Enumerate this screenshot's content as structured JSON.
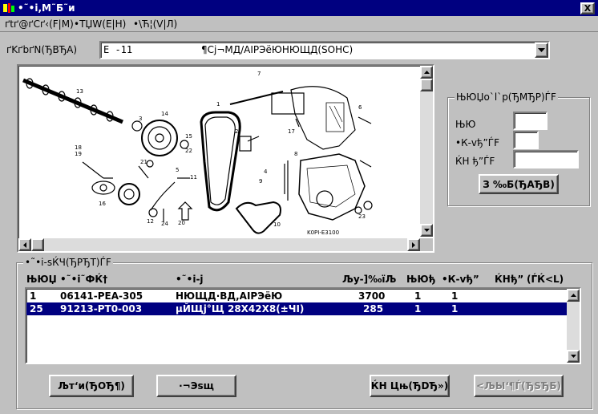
{
  "window": {
    "title": "•˜•i,M˜Б˜и",
    "close_label": "X"
  },
  "menu": {
    "items": [
      "ґtґ@ґCґ‹(F|M)",
      "•TЏW(E|H)",
      "•\\Ћ¦(V|Л)"
    ]
  },
  "model": {
    "label": "ґKґbґN(ЂВЂА)",
    "code": "E  -11",
    "name": "¶Cj¬МД/AIРЭёЮНЮЩД(SOHC)"
  },
  "quantity_panel": {
    "title": "ЊЮЏo`l`p(ЂМЂР)ЃF",
    "fields": [
      {
        "label": "ЊЮ",
        "value": ""
      },
      {
        "label": "•К-vђ”ЃF",
        "value": ""
      },
      {
        "label": "ЌН  ђ”ЃF",
        "value": ""
      }
    ],
    "confirm_label": "З ‰Б(ЂАЂВ)"
  },
  "parts_panel": {
    "title": "•˜•i-sЌЧ(ЂРЂТ)ЃF",
    "columns": [
      "ЊЮЏ",
      "•˜•i˜ФЌ†",
      "•˜•i-j",
      "Љу-]‰їЉ",
      "ЊЮђ",
      "•К-vђ”",
      "ЌНђ”",
      "(ЃЌ<L)"
    ],
    "rows": [
      {
        "no": "1",
        "part_no": "06141-PEA-305",
        "name": "НЮЩД·ВД,AIРЭёЮ",
        "price": "3700",
        "qty": "1",
        "need": "1",
        "input": "",
        "selected": false
      },
      {
        "no": "25",
        "part_no": "91213-PT0-003",
        "name": "µЙЩj°Щ 28X42X8(±ЧI)",
        "price": "285",
        "qty": "1",
        "need": "1",
        "input": "",
        "selected": true
      }
    ],
    "buttons": {
      "search": "Љт‘и(ЂОЂ¶)",
      "clear": "·¬Эѕщ",
      "add": "ЌН  Цњ(ЂDЂ»)",
      "delete": "<ЉЫ‘¶Ѓ(ЂЅЂБ)"
    }
  },
  "diagram": {
    "caption": "K0PI-E3100",
    "callouts": [
      "13",
      "14",
      "3",
      "1",
      "7",
      "17",
      "15",
      "22",
      "5",
      "21",
      "16",
      "19",
      "4",
      "11",
      "12",
      "24",
      "20",
      "23",
      "2",
      "6",
      "8",
      "9",
      "10",
      "18"
    ]
  }
}
